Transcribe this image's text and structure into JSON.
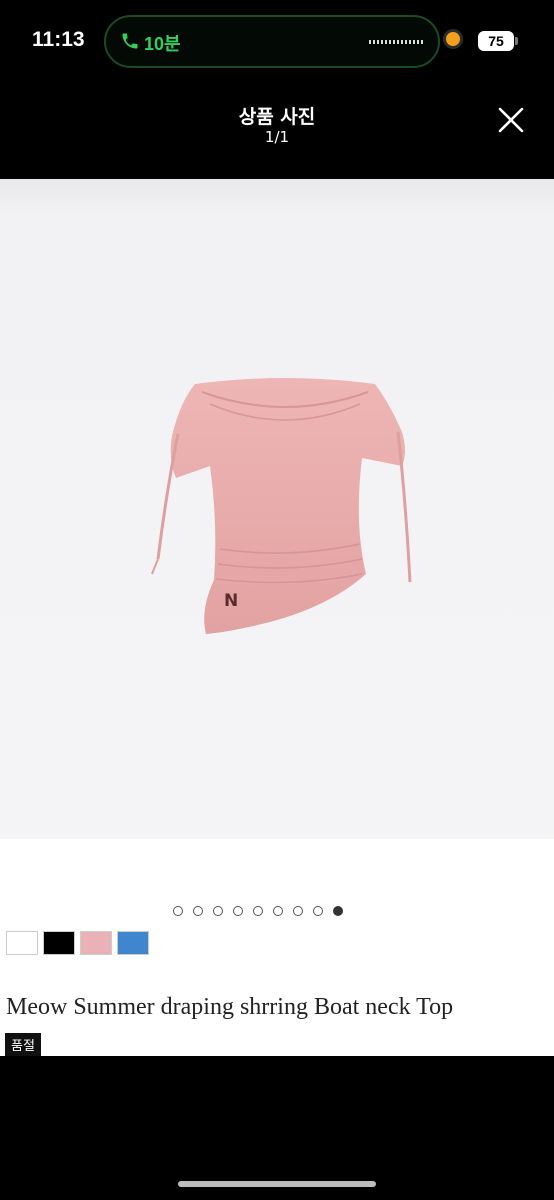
{
  "status_bar": {
    "time": "11:13",
    "call_duration": "10분",
    "battery": "75"
  },
  "header": {
    "title": "상품 사진",
    "counter": "1/1",
    "close_icon": "close-icon"
  },
  "product": {
    "name": "Meow Summer draping shrring Boat neck Top",
    "badge": "품절",
    "image_desc_icon": "pink-boat-neck-top",
    "logo_mark": "N",
    "carousel": {
      "total": 9,
      "active_index": 8
    },
    "color_swatches": [
      {
        "name": "white",
        "color": "#ffffff"
      },
      {
        "name": "black",
        "color": "#000000"
      },
      {
        "name": "pink",
        "color": "#e8b2b6"
      },
      {
        "name": "blue",
        "color": "#3f86cf"
      }
    ]
  },
  "colors": {
    "call_green": "#35d05a",
    "garment_pink": "#e6a9a9"
  }
}
